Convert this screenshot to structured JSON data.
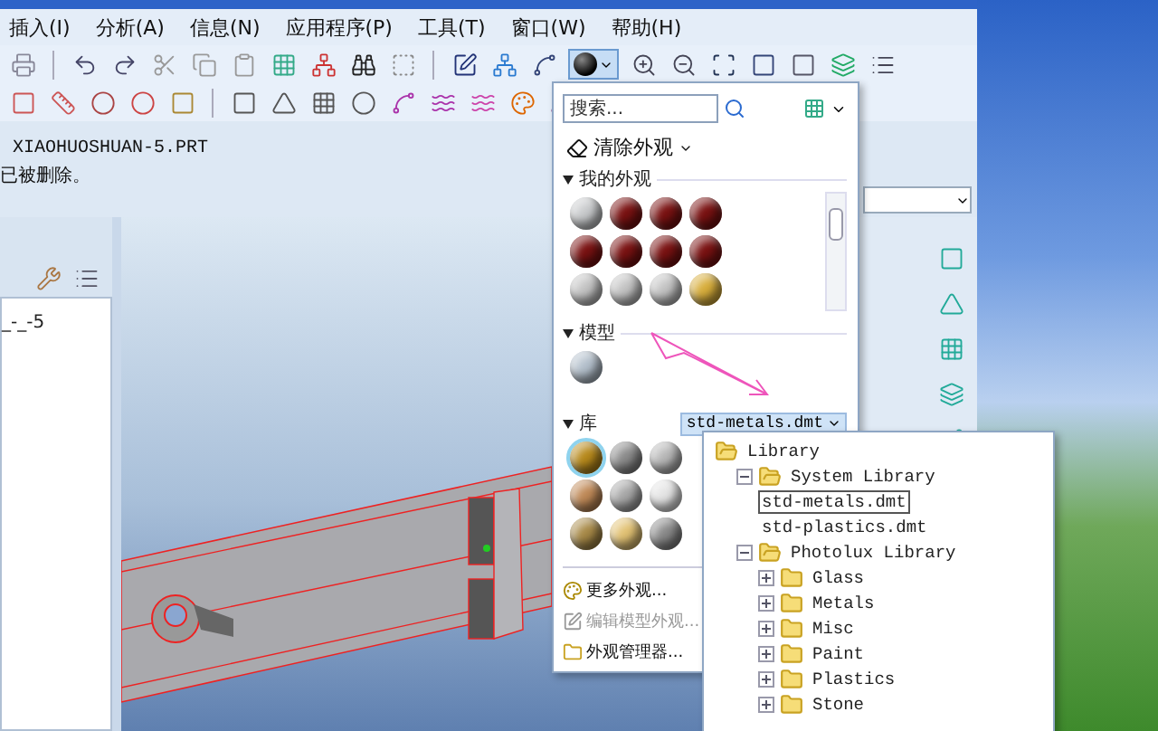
{
  "menu": [
    "插入(I)",
    "分析(A)",
    "信息(N)",
    "应用程序(P)",
    "工具(T)",
    "窗口(W)",
    "帮助(H)"
  ],
  "messages": [
    "XIAOHUOSHUAN-5.PRT",
    "已被删除。"
  ],
  "model_tree": {
    "items": [
      "_-_-5"
    ]
  },
  "appearance_button": {
    "pressed": true
  },
  "gallery": {
    "search": {
      "placeholder": "搜索..."
    },
    "clear_button": "清除外观",
    "sections": [
      {
        "title": "我的外观",
        "kind": "scroll",
        "swatches": [
          {
            "color": "#c8cacc",
            "selected": false
          },
          {
            "color": "#7a1212",
            "selected": false
          },
          {
            "color": "#7a1212",
            "selected": false
          },
          {
            "color": "#7a1212",
            "selected": false
          },
          {
            "color": "#7a1212",
            "selected": false
          },
          {
            "color": "#7a1212",
            "selected": false
          },
          {
            "color": "#7a1212",
            "selected": false
          },
          {
            "color": "#7a1212",
            "selected": false
          },
          {
            "color": "#c4c4c4",
            "selected": false
          },
          {
            "color": "#c4c4c4",
            "selected": false
          },
          {
            "color": "#c4c4c4",
            "selected": false
          },
          {
            "color": "#d8ae3c",
            "selected": false
          }
        ]
      },
      {
        "title": "模型",
        "kind": "plain",
        "swatches": [
          {
            "color": "#b4c0cc",
            "selected": false
          }
        ]
      },
      {
        "title": "库",
        "kind": "library",
        "library": "std-metals.dmt",
        "swatches": [
          {
            "color": "#b88a1c",
            "selected": true
          },
          {
            "color": "#8c8c8c",
            "selected": false
          },
          {
            "color": "#b8b8b8",
            "selected": false
          },
          {
            "color": "#c08a58",
            "selected": false
          },
          {
            "color": "#a8a8a8",
            "selected": false
          },
          {
            "color": "#e4e4e4",
            "selected": false
          },
          {
            "color": "#a88a48",
            "selected": false
          },
          {
            "color": "#e2c274",
            "selected": false
          },
          {
            "color": "#8a8a8a",
            "selected": false
          }
        ]
      }
    ],
    "actions": [
      {
        "label": "更多外观...",
        "disabled": false
      },
      {
        "label": "编辑模型外观...",
        "disabled": true
      },
      {
        "label": "外观管理器...",
        "disabled": false
      }
    ]
  },
  "library_tree": [
    {
      "label": "Library",
      "expanded": true,
      "selected": false,
      "children": [
        {
          "label": "System Library",
          "expanded": true,
          "selected": false,
          "children": [
            {
              "label": "std-metals.dmt",
              "selected": true
            },
            {
              "label": "std-plastics.dmt",
              "selected": false
            }
          ]
        },
        {
          "label": "Photolux Library",
          "expanded": true,
          "selected": false,
          "children": [
            {
              "label": "Glass",
              "expanded": false,
              "selected": false
            },
            {
              "label": "Metals",
              "expanded": false,
              "selected": false
            },
            {
              "label": "Misc",
              "expanded": false,
              "selected": false
            },
            {
              "label": "Paint",
              "expanded": false,
              "selected": false
            },
            {
              "label": "Plastics",
              "expanded": false,
              "selected": false
            },
            {
              "label": "Stone",
              "expanded": false,
              "selected": false
            }
          ]
        }
      ]
    }
  ]
}
